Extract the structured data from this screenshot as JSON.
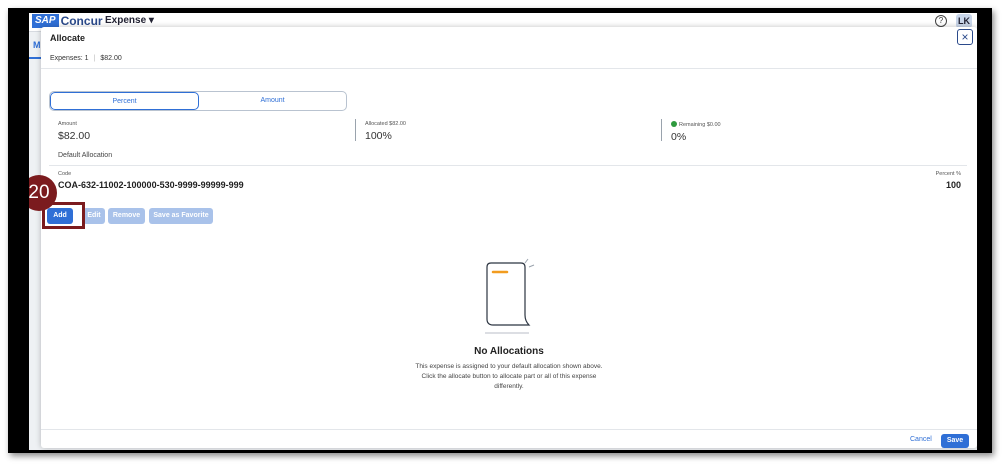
{
  "app": {
    "brand_sap": "SAP",
    "brand_concur": "Concur",
    "menu": "Expense",
    "avatar_initials": "LK",
    "help_glyph": "?",
    "background_tab": "M"
  },
  "modal": {
    "title": "Allocate",
    "close_glyph": "×",
    "summary": {
      "expenses": "Expenses: 1",
      "separator": "|",
      "total": "$82.00"
    },
    "segmented": {
      "percent": "Percent",
      "amount": "Amount",
      "active": "Percent"
    },
    "stats": {
      "amount_label": "Amount",
      "amount_value": "$82.00",
      "allocated_label": "Allocated $82.00",
      "allocated_value": "100%",
      "remaining_label": "Remaining $0.00",
      "remaining_value": "0%"
    },
    "default_allocation": {
      "heading": "Default Allocation",
      "code_label": "Code",
      "code_value": "COA-632-11002-100000-530-9999-99999-999",
      "percent_label": "Percent %",
      "percent_value": "100"
    },
    "buttons": {
      "add": "Add",
      "edit": "Edit",
      "remove": "Remove",
      "save_favorite": "Save as Favorite"
    },
    "empty_state": {
      "title": "No Allocations",
      "line1": "This expense is assigned to your default allocation shown above.",
      "line2": "Click the allocate button to allocate part or all of this expense",
      "line3": "differently."
    },
    "footer": {
      "cancel": "Cancel",
      "save": "Save"
    }
  },
  "annotation": {
    "step_number": "20"
  },
  "colors": {
    "accent": "#2f6fd6",
    "annotation": "#7b1b1e",
    "success": "#2e9a3e",
    "illustration_accent": "#f29c1f"
  }
}
